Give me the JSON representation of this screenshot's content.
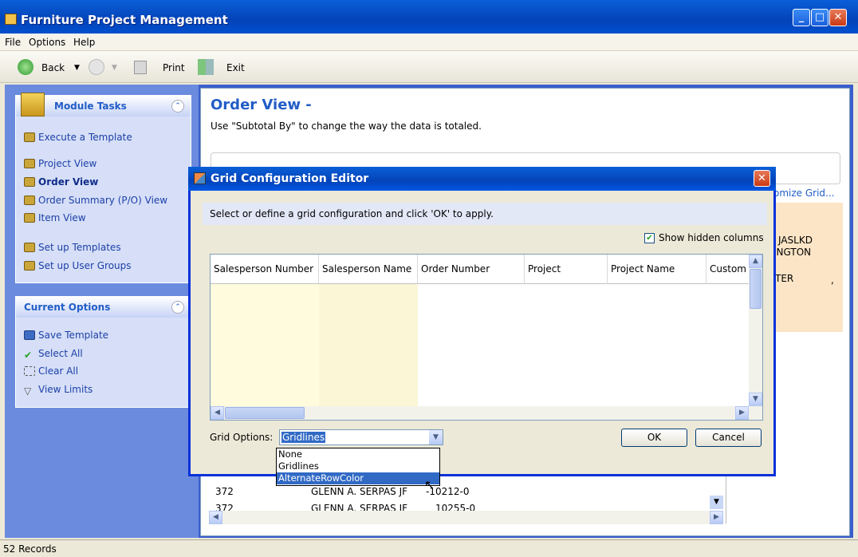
{
  "window": {
    "title": "Furniture Project Management"
  },
  "menu": {
    "file": "File",
    "options": "Options",
    "help": "Help"
  },
  "toolbar": {
    "back": "Back",
    "print": "Print",
    "exit": "Exit"
  },
  "sidebar": {
    "module_tasks": {
      "title": "Module Tasks",
      "items": [
        "Execute a Template",
        "Project View",
        "Order View",
        "Order Summary (P/O) View",
        "Item View",
        "Set up Templates",
        "Set up User Groups"
      ]
    },
    "current_options": {
      "title": "Current Options",
      "items": [
        "Save Template",
        "Select All",
        "Clear All",
        "View Limits"
      ]
    }
  },
  "main": {
    "title": "Order View -",
    "subtitle": "Use \"Subtotal By\" to change the way the data is totaled.",
    "customize_link": "omize Grid...",
    "right_text": [
      "JASLKD",
      "INGTON",
      "TER",
      ","
    ],
    "bg_rows": [
      {
        "sp": "372",
        "name": "GLENN A. SERPAS JF",
        "order": "-10212-0"
      },
      {
        "sp": "372",
        "name": "GLENN A. SERPAS JF",
        "order": "10255-0"
      }
    ]
  },
  "dialog": {
    "title": "Grid Configuration Editor",
    "instruction": "Select or define a grid configuration and click 'OK' to apply.",
    "show_hidden_label": "Show hidden columns",
    "show_hidden_checked": true,
    "columns": [
      "Salesperson Number",
      "Salesperson Name",
      "Order Number",
      "Project",
      "Project Name",
      "Custom"
    ],
    "grid_options_label": "Grid Options:",
    "grid_options_value": "Gridlines",
    "grid_options_list": [
      "None",
      "Gridlines",
      "AlternateRowColor"
    ],
    "highlighted_option": "AlternateRowColor",
    "ok": "OK",
    "cancel": "Cancel"
  },
  "status": {
    "records": "52 Records"
  }
}
